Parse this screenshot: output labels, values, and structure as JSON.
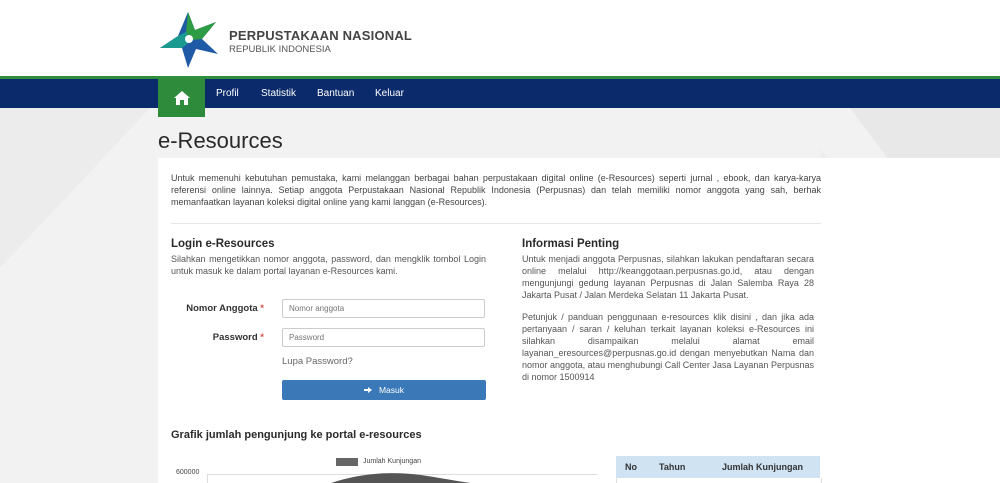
{
  "header": {
    "brand_title": "PERPUSTAKAAN NASIONAL",
    "brand_subtitle": "REPUBLIK INDONESIA",
    "logo_icon": "star-logo-icon",
    "colors": {
      "nav": "#0b2a6b",
      "green": "#2e8b3c",
      "blue_star": "#1f5aa6"
    }
  },
  "nav": {
    "home_icon": "home-icon",
    "items": [
      "Profil",
      "Statistik",
      "Bantuan",
      "Keluar"
    ]
  },
  "page": {
    "title": "e-Resources",
    "intro": "Untuk memenuhi kebutuhan pemustaka, kami melanggan berbagai bahan perpustakaan digital online (e-Resources) seperti jurnal , ebook, dan karya-karya referensi online lainnya. Setiap anggota Perpustakaan Nasional Republik Indonesia (Perpusnas) dan telah memiliki nomor anggota yang sah, berhak memanfaatkan layanan koleksi digital online yang kami langgan (e-Resources)."
  },
  "login": {
    "heading": "Login e-Resources",
    "description": "Silahkan mengetikkan nomor anggota, password, dan mengklik tombol Login untuk masuk ke dalam portal layanan e-Resources kami.",
    "member_label": "Nomor Anggota",
    "member_placeholder": "Nomor anggota",
    "password_label": "Password",
    "password_placeholder": "Password",
    "required_mark": "*",
    "forgot": "Lupa Password?",
    "submit": "Masuk"
  },
  "info": {
    "heading": "Informasi Penting",
    "para1": "Untuk menjadi anggota Perpusnas, silahkan lakukan pendaftaran secara online melalui http://keanggotaan.perpusnas.go.id, atau dengan mengunjungi gedung layanan Perpusnas di Jalan Salemba Raya 28 Jakarta Pusat / Jalan Merdeka Selatan 11 Jakarta Pusat.",
    "para2": "Petunjuk / panduan penggunaan e-resources klik disini , dan jika ada pertanyaan / saran / keluhan terkait layanan koleksi e-Resources ini silahkan disampaikan melalui alamat email layanan_eresources@perpusnas.go.id dengan menyebutkan Nama dan nomor anggota, atau menghubungi Call Center Jasa Layanan Perpusnas di nomor 1500914"
  },
  "chart": {
    "title": "Grafik jumlah pengunjung ke portal e-resources",
    "legend": "Jumlah Kunjungan",
    "y_top_tick": "600000"
  },
  "table": {
    "headers": [
      "No",
      "Tahun",
      "Jumlah Kunjungan"
    ]
  }
}
